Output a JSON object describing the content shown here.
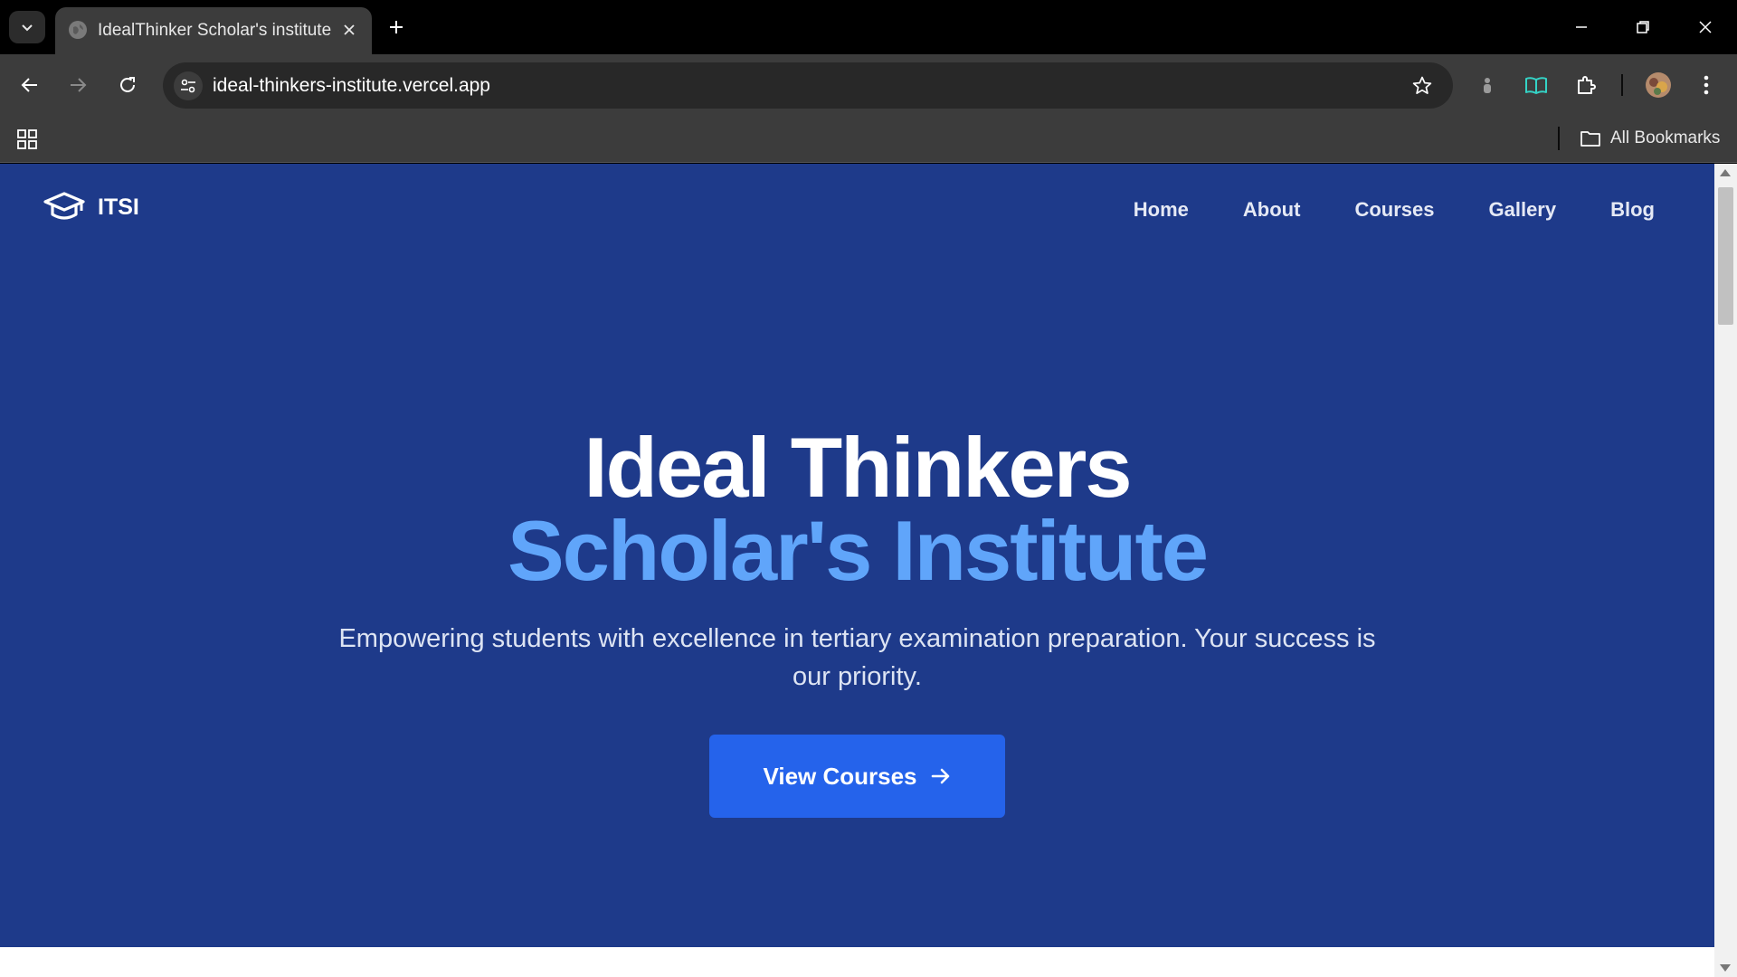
{
  "browser": {
    "tab_title": "IdealThinker Scholar's institute",
    "url": "ideal-thinkers-institute.vercel.app",
    "bookmarks_label": "All Bookmarks"
  },
  "site": {
    "brand": "ITSI",
    "nav": [
      "Home",
      "About",
      "Courses",
      "Gallery",
      "Blog"
    ]
  },
  "hero": {
    "title_line1": "Ideal Thinkers",
    "title_line2": "Scholar's Institute",
    "subtitle": "Empowering students with excellence in tertiary examination preparation. Your success is our priority.",
    "cta_label": "View Courses"
  },
  "icons": {
    "tab_search": "chevron-down-icon",
    "favicon": "globe-icon",
    "tab_close": "close-icon",
    "new_tab": "plus-icon",
    "back": "arrow-left-icon",
    "forward": "arrow-right-icon",
    "reload": "reload-icon",
    "site_info": "tune-icon",
    "bookmark": "star-icon",
    "extensions": "puzzle-icon",
    "menu": "kebab-icon",
    "brand": "graduation-cap-icon",
    "cta": "arrow-right-icon"
  },
  "colors": {
    "page_bg": "#1e3a8a",
    "accent_text": "#60a5fa",
    "cta_bg": "#2563eb"
  }
}
